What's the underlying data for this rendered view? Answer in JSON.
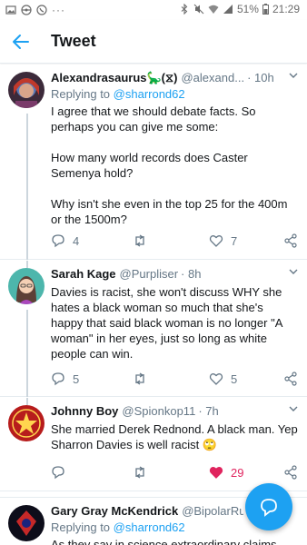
{
  "status_bar": {
    "battery": "51%",
    "time": "21:29"
  },
  "header": {
    "title": "Tweet"
  },
  "colors": {
    "accent": "#1da1f2",
    "secondary_text": "#657786",
    "like_active": "#e0245e"
  },
  "tweets": [
    {
      "display_name": "Alexandrasaurus",
      "name_suffix": "🦕(⧖)",
      "handle": "@alexand...",
      "time": "· 10h",
      "replying_label": "Replying to ",
      "replying_to": "@sharrond62",
      "body": "I agree that we should debate facts. So perhaps you can give me some:\n\nHow many world records does Caster Semenya hold?\n\nWhy isn't she even in the top 25 for the 400m or the 1500m?",
      "replies": "4",
      "retweets": "",
      "likes": "7"
    },
    {
      "display_name": "Sarah Kage",
      "name_suffix": "",
      "handle": "@Purpliser",
      "time": "· 8h",
      "replying_label": "",
      "replying_to": "",
      "body": "Davies is racist, she won't discuss WHY she hates a black woman so much that she's happy that said black woman is no longer \"A woman\" in her eyes, just so long as white people can win.",
      "replies": "5",
      "retweets": "",
      "likes": "5"
    },
    {
      "display_name": "Johnny Boy",
      "name_suffix": "",
      "handle": "@Spionkop11",
      "time": "· 7h",
      "replying_label": "",
      "replying_to": "",
      "body": "She married Derek Rednond. A black man. Yep Sharron Davies is well racist 🙄",
      "replies": "",
      "retweets": "",
      "likes": "29"
    },
    {
      "display_name": "Gary Gray McKendrick",
      "name_suffix": "",
      "handle": "@BipolarRu...",
      "time": "",
      "replying_label": "Replying to ",
      "replying_to": "@sharrond62",
      "body": "As they say in science extraordinary claims",
      "replies": "",
      "retweets": "",
      "likes": ""
    }
  ]
}
